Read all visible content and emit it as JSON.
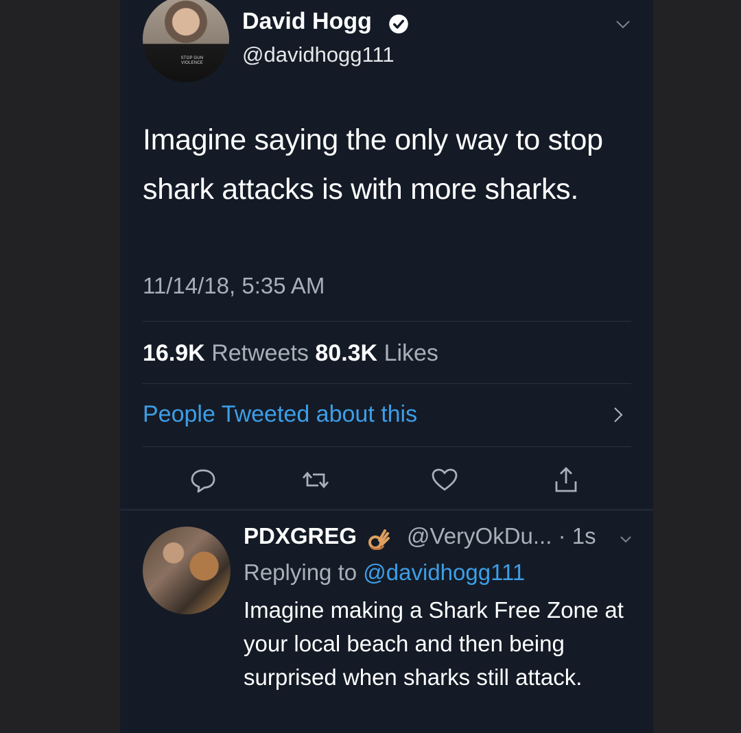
{
  "tweet": {
    "author_name": "David Hogg",
    "author_handle": "@davidhogg111",
    "avatar_shirt_text": "STOP GUN VIOLENCE",
    "text": "Imagine saying the only way to stop shark attacks is with more sharks.",
    "timestamp": "11/14/18, 5:35 AM",
    "retweets_count": "16.9K",
    "retweets_label": "Retweets",
    "likes_count": "80.3K",
    "likes_label": "Likes",
    "people_tweeted": "People Tweeted about this"
  },
  "actions": {
    "reply": "reply-icon",
    "retweet": "retweet-icon",
    "like": "heart-icon",
    "share": "share-icon"
  },
  "reply": {
    "author_name": "PDXGREG",
    "author_handle": "@VeryOkDu...",
    "time": "· 1s",
    "replying_to_label": "Replying to",
    "replying_to_handle": "@davidhogg111",
    "text": "Imagine making a Shark Free Zone at your local beach and then being surprised when sharks still attack."
  },
  "colors": {
    "background": "#141b26",
    "link": "#3d9ee8",
    "muted": "#a8b0b9"
  }
}
